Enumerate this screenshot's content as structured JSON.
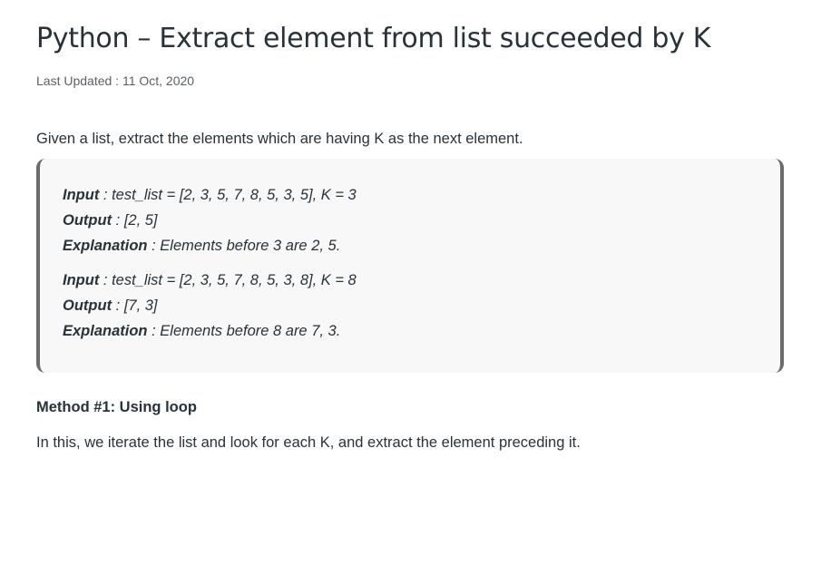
{
  "article": {
    "title": "Python – Extract element from list succeeded by K",
    "last_updated": "Last Updated : 11 Oct, 2020",
    "intro": "Given a list, extract the elements which are having K as the next element.",
    "examples": [
      {
        "input_key": "Input",
        "input_value": " : test_list = [2, 3, 5, 7, 8, 5, 3, 5], K = 3",
        "output_key": "Output",
        "output_value": " : [2, 5]",
        "explanation_key": "Explanation",
        "explanation_value": " : Elements before 3 are 2, 5."
      },
      {
        "input_key": "Input",
        "input_value": " : test_list = [2, 3, 5, 7, 8, 5, 3, 8], K = 8",
        "output_key": "Output",
        "output_value": " : [7, 3]",
        "explanation_key": "Explanation",
        "explanation_value": " : Elements before 8 are 7, 3."
      }
    ],
    "method_heading": "Method #1: Using loop",
    "method_text": "In this, we iterate the list and look for each K, and extract the element preceding it."
  }
}
